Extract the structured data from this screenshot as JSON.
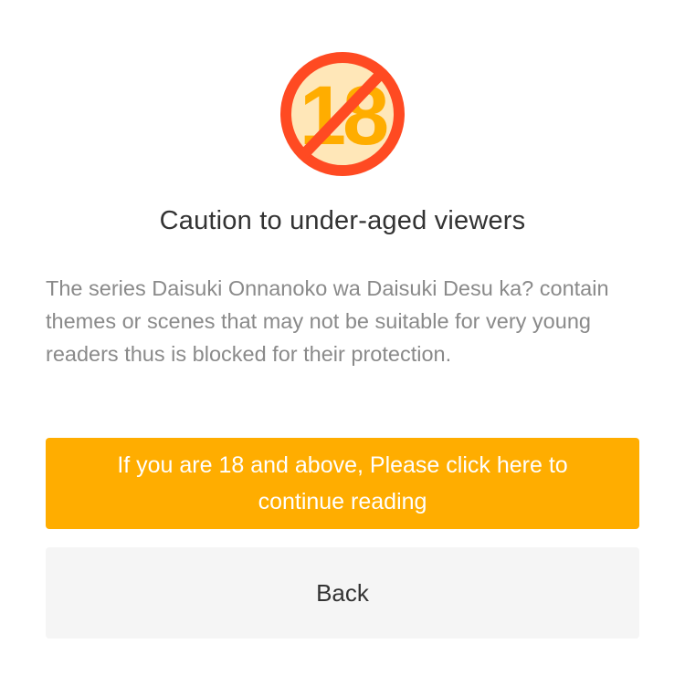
{
  "dialog": {
    "icon": {
      "name": "no-under-18-icon",
      "text": "18",
      "ring_color": "#ff4a22",
      "fill_color": "#ffe7b8",
      "number_color": "#ffad00"
    },
    "title": "Caution to under-aged viewers",
    "message": "The series Daisuki Onnanoko wa Daisuki Desu ka? contain themes or scenes that may not be suitable for very young readers thus is blocked for their protection.",
    "confirm_label": "If you are 18 and above, Please click here to continue reading",
    "back_label": "Back",
    "colors": {
      "accent": "#ffad00",
      "back_bg": "#f5f5f5",
      "title": "#333333",
      "message": "#8a8a8a"
    }
  }
}
